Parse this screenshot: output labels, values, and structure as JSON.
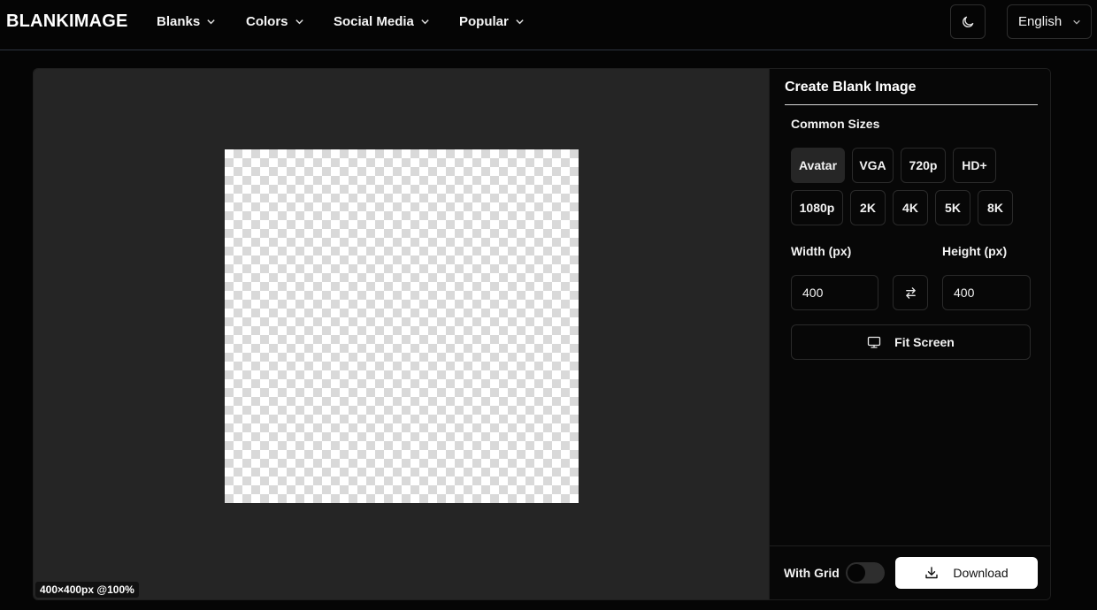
{
  "header": {
    "logo": "BLANKIMAGE",
    "nav": [
      {
        "label": "Blanks"
      },
      {
        "label": "Colors"
      },
      {
        "label": "Social Media"
      },
      {
        "label": "Popular"
      }
    ],
    "language": "English",
    "theme_icon": "moon-icon"
  },
  "canvas": {
    "size_badge": "400×400px @100%",
    "background": "transparent-checkerboard"
  },
  "panel": {
    "title": "Create Blank Image",
    "common_sizes_label": "Common Sizes",
    "sizes": [
      {
        "label": "Avatar",
        "active": true
      },
      {
        "label": "VGA"
      },
      {
        "label": "720p"
      },
      {
        "label": "HD+"
      },
      {
        "label": "1080p"
      },
      {
        "label": "2K"
      },
      {
        "label": "4K"
      },
      {
        "label": "5K"
      },
      {
        "label": "8K"
      }
    ],
    "width_label": "Width (px)",
    "height_label": "Height (px)",
    "width_value": "400",
    "height_value": "400",
    "fit_screen_label": "Fit Screen",
    "with_grid_label": "With Grid",
    "with_grid_on": false,
    "download_label": "Download"
  },
  "colors": {
    "background": "#050505",
    "canvas_bg": "#252525",
    "active_size": "#262626",
    "download_bg": "#ffffff"
  }
}
